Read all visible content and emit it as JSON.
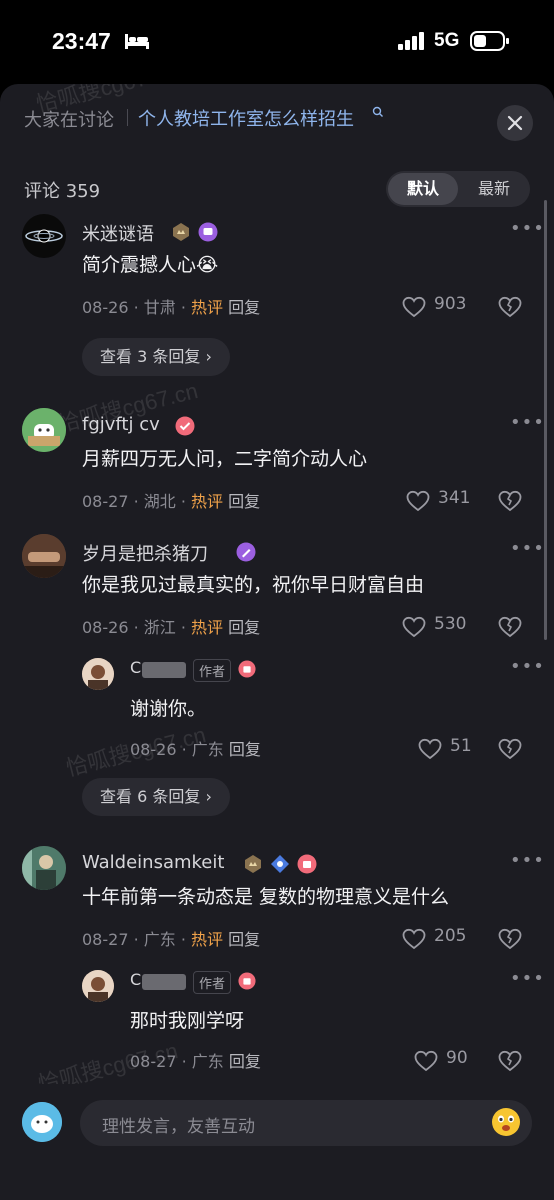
{
  "status_bar": {
    "time": "23:47",
    "network": "5G"
  },
  "header": {
    "discussing_label": "大家在讨论",
    "topic": "个人教培工作室怎么样招生",
    "watermark": "恰呱搜cg67.cn"
  },
  "comments_header": {
    "count_label": "评论 359",
    "sort_default": "默认",
    "sort_latest": "最新"
  },
  "comments": [
    {
      "user": "米迷谜语",
      "text": "简介震撼人心😭",
      "date": "08-26",
      "location": "甘肃",
      "hot": "热评",
      "reply": "回复",
      "likes": "903",
      "view_replies": "查看 3 条回复 ›"
    },
    {
      "user": "fgjvftj cv",
      "text": "月薪四万无人问，二字简介动人心",
      "date": "08-27",
      "location": "湖北",
      "hot": "热评",
      "reply": "回复",
      "likes": "341"
    },
    {
      "user": "岁月是把杀猪刀",
      "text": "你是我见过最真实的，祝你早日财富自由",
      "date": "08-26",
      "location": "浙江",
      "hot": "热评",
      "reply": "回复",
      "likes": "530",
      "view_replies": "查看 6 条回复 ›",
      "sub": {
        "user": "C",
        "author_tag": "作者",
        "text": "谢谢你。",
        "date": "08-26",
        "location": "广东",
        "reply": "回复",
        "likes": "51"
      }
    },
    {
      "user": "Waldeinsamkeit",
      "text": "十年前第一条动态是 复数的物理意义是什么",
      "date": "08-27",
      "location": "广东",
      "hot": "热评",
      "reply": "回复",
      "likes": "205",
      "sub": {
        "user": "C",
        "author_tag": "作者",
        "text": "那时我刚学呀",
        "date": "08-27",
        "location": "广东",
        "reply": "回复",
        "likes": "90"
      }
    }
  ],
  "input": {
    "placeholder": "理性发言，友善互动"
  },
  "colors": {
    "background": "#1c1c22",
    "hot": "#f0a24a",
    "topic": "#8fb5ec"
  }
}
